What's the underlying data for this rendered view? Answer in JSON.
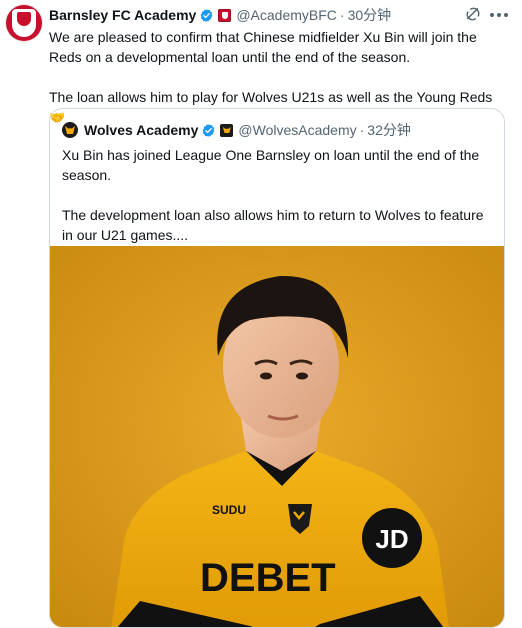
{
  "tweet": {
    "author_name": "Barnsley FC Academy",
    "author_handle": "@AcademyBFC",
    "separator": "·",
    "time": "30分钟",
    "paragraphs": [
      "We are pleased to confirm that Chinese midfielder Xu Bin will join the Reds on a developmental loan until the end of the season.",
      "The loan allows him to play for Wolves U21s as well as the Young Reds"
    ],
    "emoji": "🤝"
  },
  "quote": {
    "author_name": "Wolves Academy",
    "author_handle": "@WolvesAcademy",
    "separator": "·",
    "time": "32分钟",
    "paragraphs": [
      "Xu Bin has joined League One Barnsley on loan until the end of the season.",
      "The development loan also allows him to return to Wolves to feature in our U21 games...."
    ],
    "image": {
      "background_color": "#e0a01a",
      "shirt_text": [
        "SUDU",
        "DEBET",
        "JD"
      ]
    }
  },
  "colors": {
    "verified_blue": "#1d9bf0",
    "secondary_text": "#536471",
    "border": "#cfd9de",
    "barnsley_red": "#c8102e",
    "wolves_gold": "#f2a900"
  },
  "icons": [
    "verified-icon",
    "grok-icon",
    "more-icon"
  ]
}
